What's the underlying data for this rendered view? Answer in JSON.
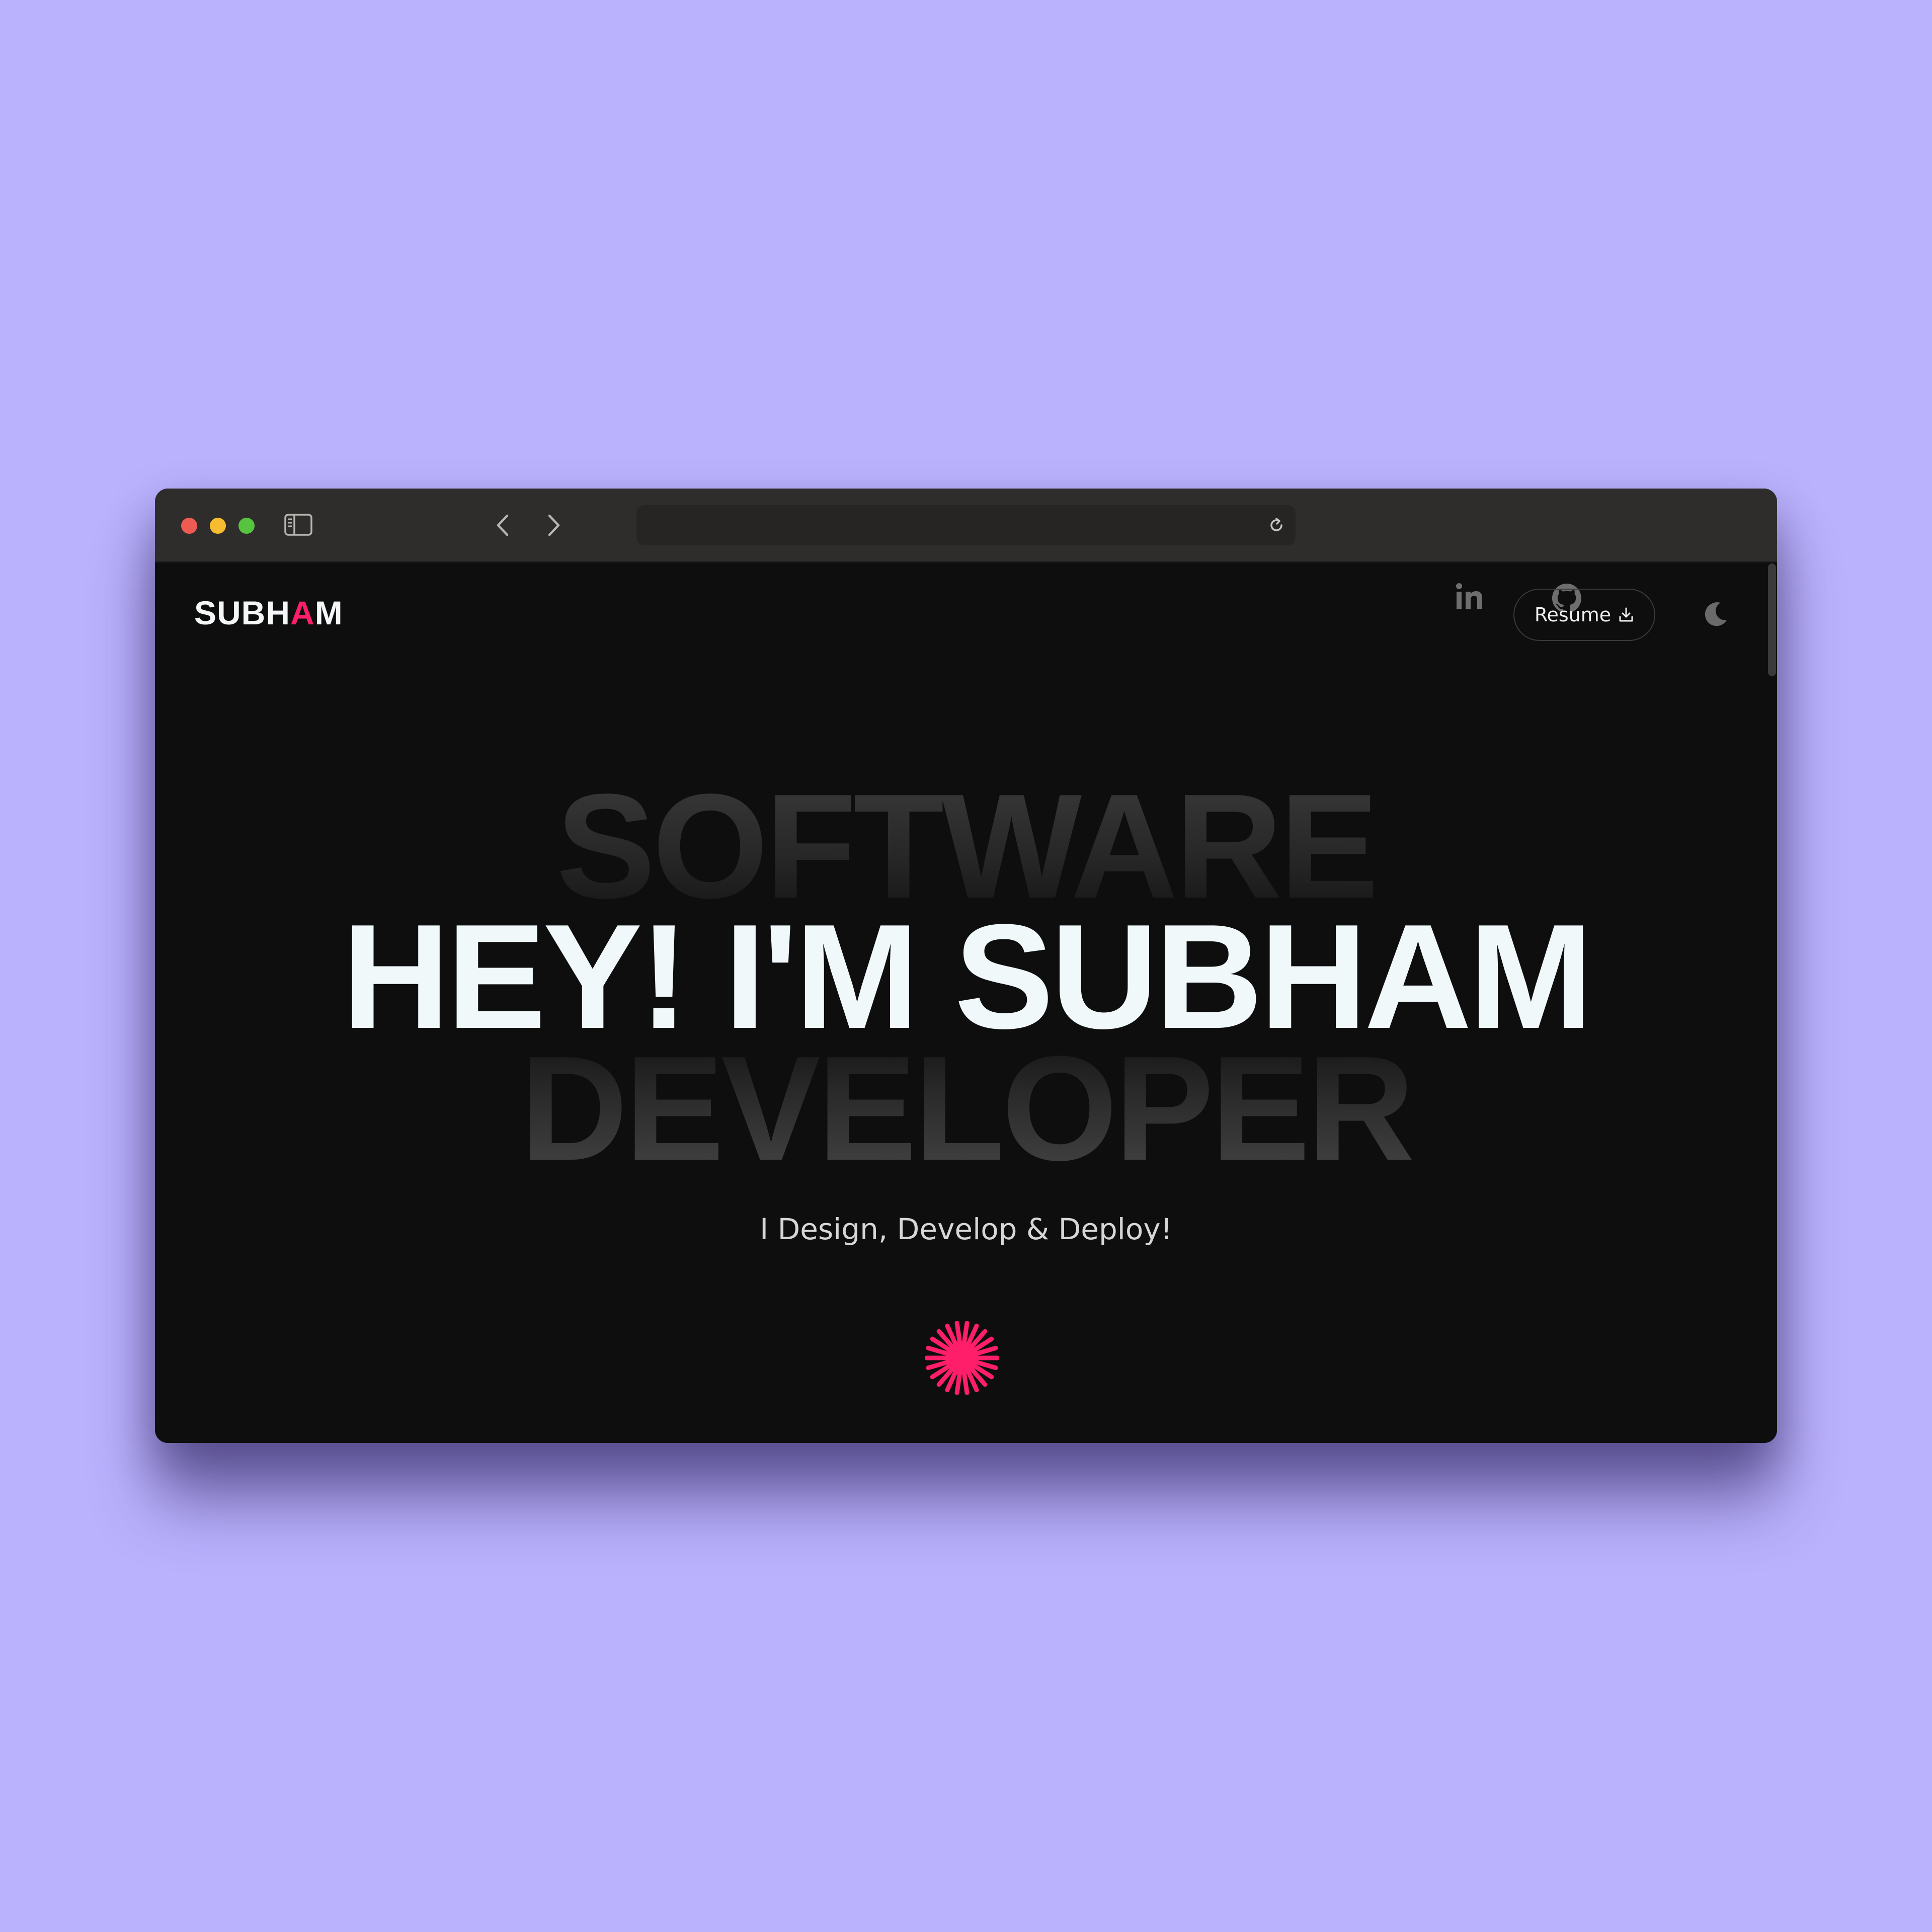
{
  "browser": {
    "url": "",
    "icons": {
      "sidebar": "sidebar-icon",
      "back": "chevron-left-icon",
      "forward": "chevron-right-icon",
      "reload": "reload-icon",
      "share": "share-icon",
      "new_tab": "plus-icon",
      "tabs": "tab-overview-icon"
    }
  },
  "header": {
    "logo_prefix": "SUBH",
    "logo_accent": "A",
    "logo_suffix": "M",
    "linkedin_icon": "linkedin-icon",
    "github_icon": "github-icon",
    "resume_label": "Resume",
    "resume_icon": "download-icon",
    "theme_icon": "moon-icon"
  },
  "hero": {
    "top_word": "SOFTWARE",
    "headline": "HEY! I'M SUBHAM",
    "bottom_word": "DEVELOPER",
    "tagline": "I Design, Develop & Deploy!",
    "decoration_icon": "starburst-icon"
  },
  "colors": {
    "backdrop": "#bbb2fe",
    "page_background": "#0e0e0e",
    "titlebar": "#2f2d2b",
    "accent": "#ff1e6a",
    "headline": "#f0f8fa"
  }
}
